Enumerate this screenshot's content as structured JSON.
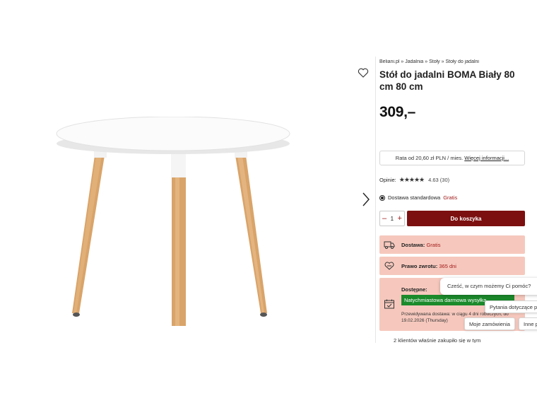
{
  "breadcrumb": [
    "Beliani.pl",
    "»",
    "Jadalnia",
    "»",
    "Stoły",
    "»",
    "Stoły do jadalni"
  ],
  "product": {
    "title": "Stół do jadalni BOMA Biały 80 cm 80 cm",
    "price": "309,–"
  },
  "installment": {
    "text": "Rata od 20,60 zł PLN / mies.",
    "link": "Więcej informacji..."
  },
  "reviews": {
    "label": "Opinie:",
    "stars": "★★★★★",
    "score": "4.63 (30)",
    "rating_value": 4.63
  },
  "shipping": {
    "label": "Dostawa standardowa",
    "price": "Gratis"
  },
  "quantity": {
    "minus": "–",
    "value": "1",
    "plus": "+"
  },
  "cart_button": "Do koszyka",
  "info_boxes": {
    "delivery_label": "Dostawa:",
    "delivery_value": "Gratis",
    "return_label": "Prawo zwrotu:",
    "return_value": "365 dni",
    "availability_label": "Dostępne:",
    "availability_banner": "Natychmiastowa darmowa wysyłka",
    "estimate": "Przewidywana dostawa: w ciągu 4 dni roboczych, do 19.02.2026 (Thursday)"
  },
  "clients_text": "2 klientów właśnie zakupiło się w tym",
  "chat": {
    "greeting": "Cześć, w czym możemy Ci pomóc?",
    "chip_questions": "Pytania dotyczące pr",
    "chip_orders": "Moje zamówienia",
    "chip_other": "Inne p"
  },
  "colors": {
    "accent": "#7c0f0f",
    "accent_text": "#a11a1a",
    "info_box": "#f6c8bd",
    "available": "#1b8a2b"
  },
  "icons": [
    "heart-icon",
    "chevron-right-icon",
    "truck-icon",
    "return-icon",
    "calendar-check-icon",
    "star-icon"
  ]
}
